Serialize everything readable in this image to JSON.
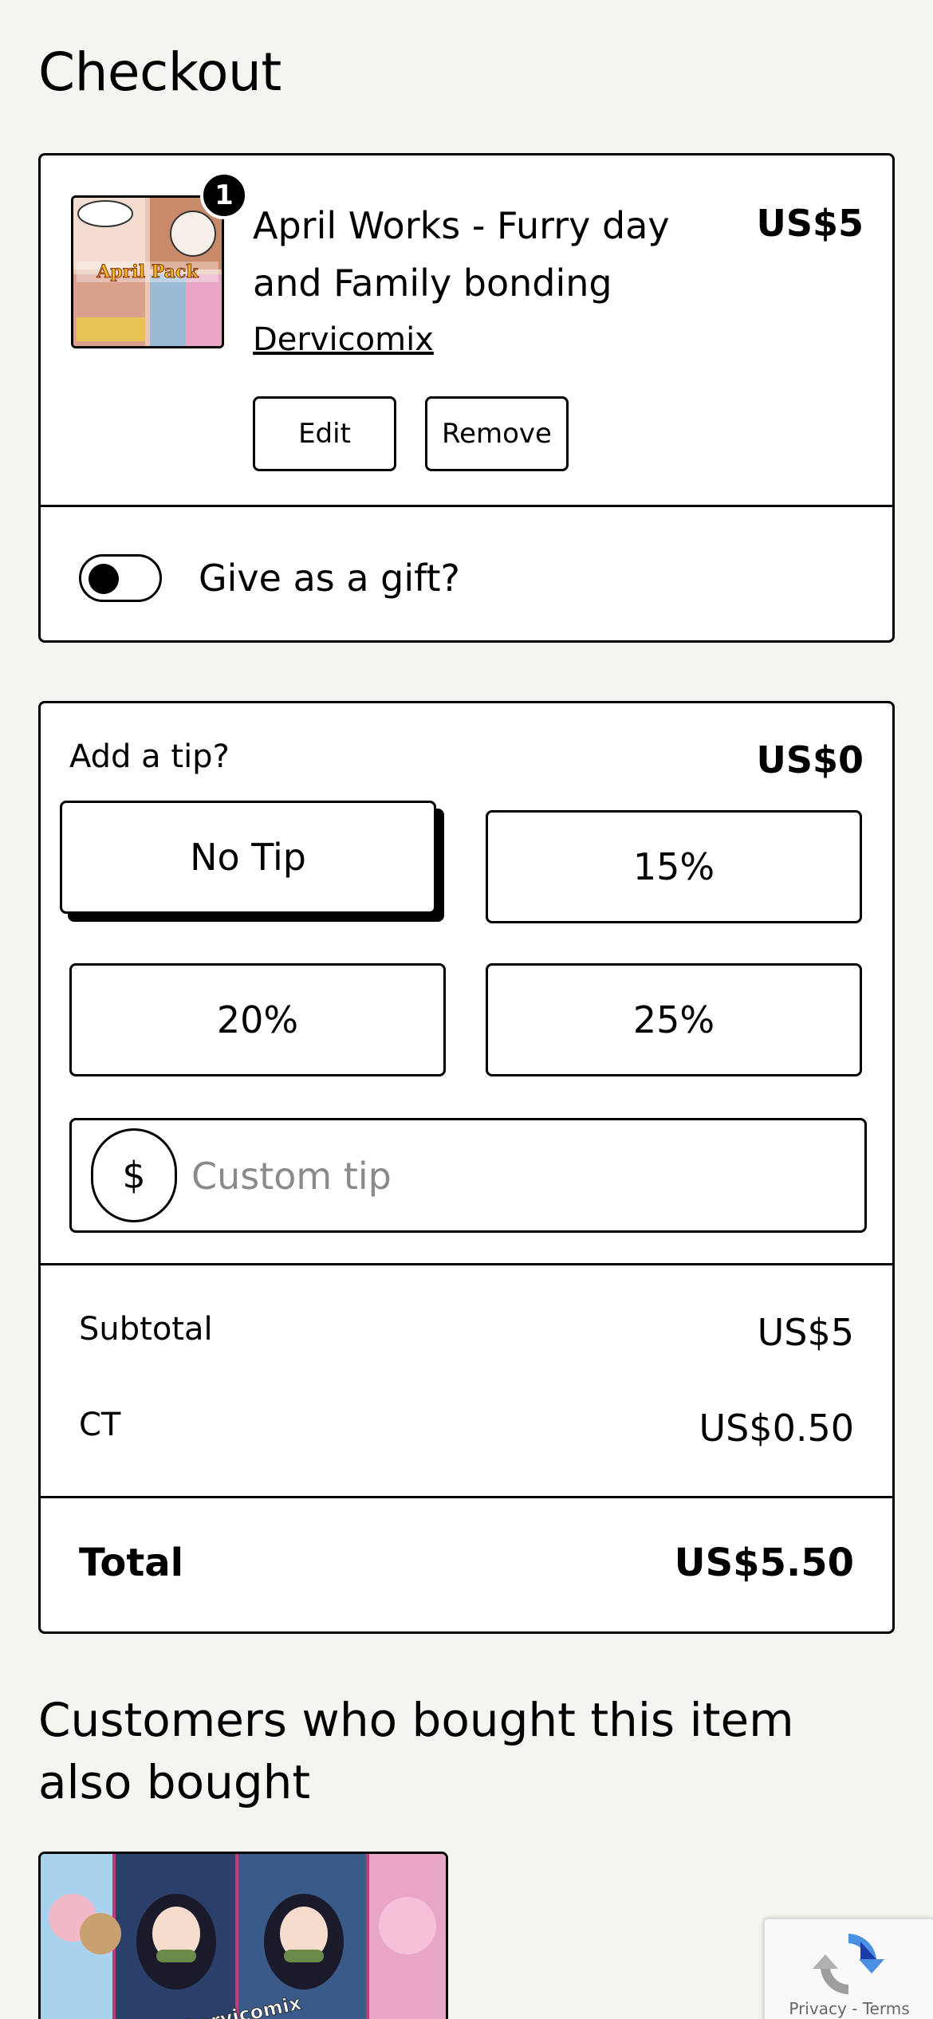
{
  "page": {
    "title": "Checkout"
  },
  "cart_item": {
    "badge_count": "1",
    "name": "April Works - Furry day and Family bonding",
    "price": "US$5",
    "creator": "Dervicomix",
    "edit_label": "Edit",
    "remove_label": "Remove",
    "thumbnail_text": "April Pack"
  },
  "gift": {
    "label": "Give as a gift?",
    "enabled": false
  },
  "tip": {
    "title": "Add a tip?",
    "amount": "US$0",
    "options": [
      "No Tip",
      "15%",
      "20%",
      "25%"
    ],
    "selected": "No Tip",
    "custom_symbol": "$",
    "custom_placeholder": "Custom tip"
  },
  "summary": {
    "subtotal_label": "Subtotal",
    "subtotal_value": "US$5",
    "tax_label": "CT",
    "tax_value": "US$0.50",
    "total_label": "Total",
    "total_value": "US$5.50"
  },
  "recommendations": {
    "title": "Customers who bought this item also bought",
    "thumbnail_text": "Dervicomix"
  },
  "recaptcha": {
    "text": "Privacy - Terms"
  },
  "colors": {
    "background": "#f4f4f0",
    "border": "#000000",
    "placeholder": "#8a8a8a"
  }
}
